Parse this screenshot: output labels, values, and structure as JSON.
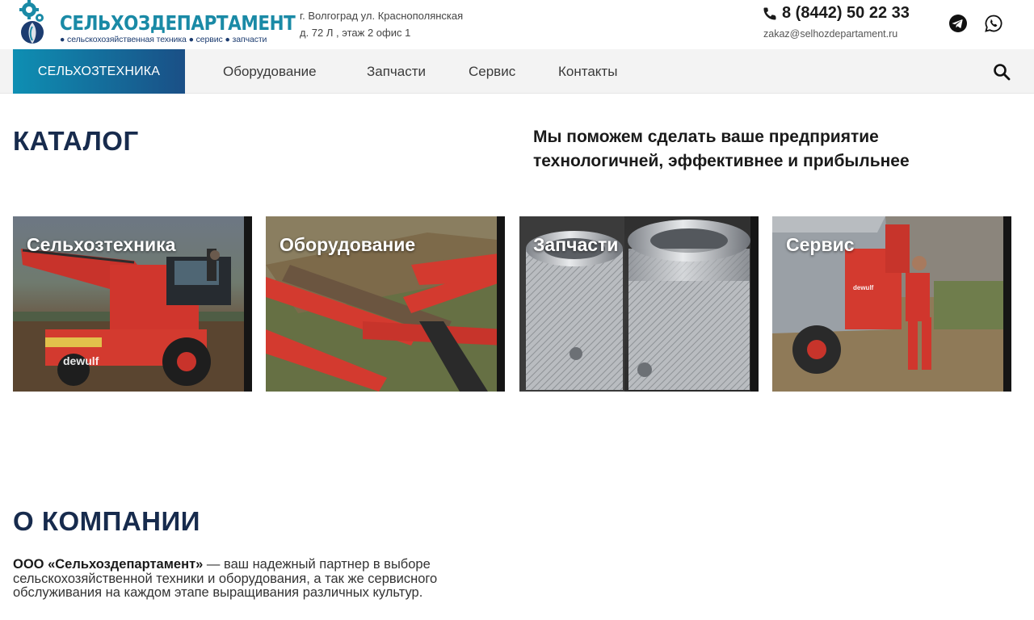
{
  "header": {
    "logo": {
      "title": "СЕЛЬХОЗДЕПАРТАМЕНТ",
      "subtitle": "● сельскохозяйственная техника ● сервис ● запчасти"
    },
    "address": {
      "line1": "г. Волгоград ул. Краснополянская",
      "line2": "д. 72 Л , этаж 2 офис 1"
    },
    "phone": "8 (8442) 50 22 33",
    "email": "zakaz@selhozdepartament.ru",
    "social": [
      {
        "icon": "telegram-icon"
      },
      {
        "icon": "whatsapp-icon"
      }
    ]
  },
  "nav": {
    "active": "СЕЛЬХОЗТЕХНИКА",
    "items": [
      "Оборудование",
      "Запчасти",
      "Сервис",
      "Контакты"
    ],
    "search_icon": "search-icon"
  },
  "catalog": {
    "title": "КАТАЛОГ",
    "tagline": "Мы поможем сделать ваше предприятие технологичней, эффективнее и прибыльнее",
    "cards": [
      {
        "label": "Сельхозтехника",
        "badge": "dewulf"
      },
      {
        "label": "Оборудование"
      },
      {
        "label": "Запчасти"
      },
      {
        "label": "Сервис",
        "badge": "dewulf"
      }
    ]
  },
  "about": {
    "title": "О КОМПАНИИ",
    "company": "ООО «Сельхоздепартамент»",
    "text": " — ваш надежный партнер в выборе сельскохозяйственной техники и оборудования, а так же сервисного обслуживания на каждом этапе выращивания различных культур."
  },
  "colors": {
    "brand_teal": "#1a8aa6",
    "brand_navy": "#172b4d",
    "nav_gradient_start": "#0e8fb3",
    "nav_gradient_end": "#1a4f86",
    "machine_red": "#d7332c"
  }
}
